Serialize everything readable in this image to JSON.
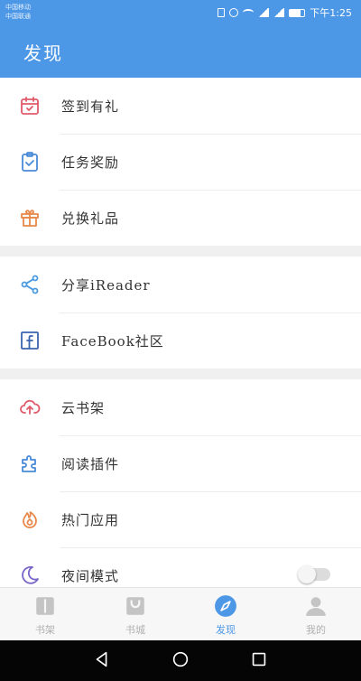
{
  "status_bar": {
    "carrier_line1": "中国移动",
    "carrier_line2": "中国联通",
    "time": "下午1:25"
  },
  "header": {
    "title": "发现"
  },
  "groups": [
    {
      "items": [
        {
          "label": "签到有礼",
          "icon": "calendar-check-icon",
          "color": "#e05a6a"
        },
        {
          "label": "任务奖励",
          "icon": "clipboard-check-icon",
          "color": "#4a8ad8"
        },
        {
          "label": "兑换礼品",
          "icon": "gift-icon",
          "color": "#e8884a"
        }
      ]
    },
    {
      "items": [
        {
          "label": "分享iReader",
          "icon": "share-icon",
          "color": "#4a9ae0"
        },
        {
          "label": "FaceBook社区",
          "icon": "facebook-icon",
          "color": "#3b64b0"
        }
      ]
    },
    {
      "items": [
        {
          "label": "云书架",
          "icon": "cloud-upload-icon",
          "color": "#e05a6a"
        },
        {
          "label": "阅读插件",
          "icon": "puzzle-icon",
          "color": "#4a8ad8"
        },
        {
          "label": "热门应用",
          "icon": "fire-app-icon",
          "color": "#e8884a"
        },
        {
          "label": "夜间模式",
          "icon": "moon-icon",
          "color": "#7a66c8",
          "toggle_on": false
        }
      ]
    }
  ],
  "tabs": [
    {
      "label": "书架",
      "icon": "book-icon",
      "active": false
    },
    {
      "label": "书城",
      "icon": "store-bag-icon",
      "active": false
    },
    {
      "label": "发现",
      "icon": "compass-icon",
      "active": true
    },
    {
      "label": "我的",
      "icon": "person-icon",
      "active": false
    }
  ],
  "colors": {
    "primary": "#4c97e6",
    "inactive_tab": "#b0b0b0"
  }
}
